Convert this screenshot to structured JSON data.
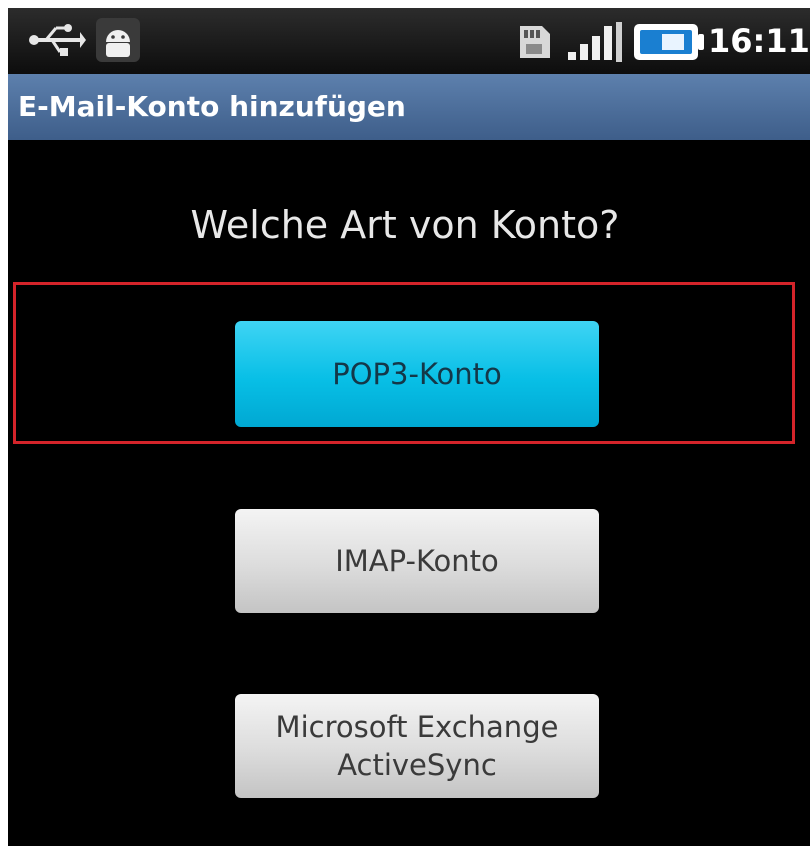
{
  "status_bar": {
    "time": "16:11",
    "icons": [
      "usb-icon",
      "android-notification-icon",
      "sd-card-icon",
      "signal-icon",
      "battery-icon"
    ]
  },
  "title_bar": {
    "title": "E-Mail-Konto hinzufügen"
  },
  "main": {
    "question": "Welche Art von Konto?",
    "buttons": {
      "pop3": "POP3-Konto",
      "imap": "IMAP-Konto",
      "exchange_line1": "Microsoft Exchange",
      "exchange_line2": "ActiveSync"
    }
  },
  "colors": {
    "title_bar": "#4a6c98",
    "pop3_button": "#08bfe6",
    "highlight_border": "#d4242a",
    "background": "#000000"
  }
}
